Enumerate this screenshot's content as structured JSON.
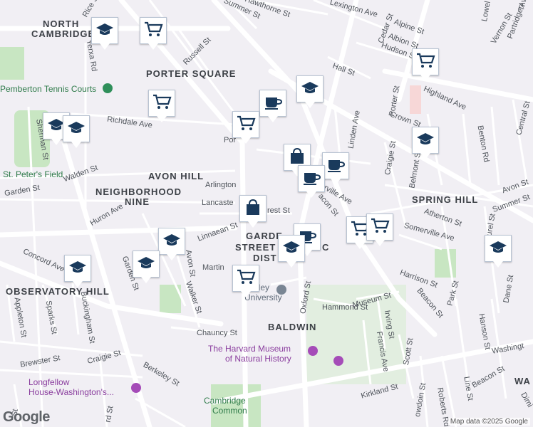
{
  "map": {
    "attribution": "Map data ©2025 Google",
    "logo": "Google",
    "neighborhoods": {
      "north_cambridge_1": "NORTH",
      "north_cambridge_2": "CAMBRIDGE",
      "porter_square": "PORTER SQUARE",
      "avon_hill": "AVON HILL",
      "neighborhood_nine_1": "NEIGHBORHOOD",
      "neighborhood_nine_2": "NINE",
      "observatory_hill": "OBSERVATORY HILL",
      "spring_hill": "SPRING HILL",
      "baldwin": "BALDWIN",
      "garden_street_1": "GARDE",
      "garden_street_2": "STREET",
      "garden_street_3": "DIST",
      "garden_street_4": "C"
    },
    "places": {
      "tennis_courts": "Pemberton Tennis Courts",
      "st_peters_field": "St. Peter's Field",
      "lesley_1": "esley",
      "lesley_2": "University",
      "harvard_museum_1": "The Harvard Museum",
      "harvard_museum_2": "of Natural History",
      "longfellow_1": "Longfellow",
      "longfellow_2": "House-Washington's...",
      "cambridge_common_1": "Cambridge",
      "cambridge_common_2": "Common",
      "porter_partial": "Por"
    },
    "streets": {
      "rice": "Rice St",
      "summer_top": "Summer St",
      "hawthorne": "Hawthorne St",
      "lexington": "Lexington Ave",
      "cedar": "Cedar St",
      "alpine": "Alpine St",
      "albion": "Albion St",
      "hudson": "Hudson St",
      "russell": "Russell St",
      "yerxa": "Yerxa Rd",
      "hall": "Hall St",
      "highland": "Highland Ave",
      "porter": "Porter St",
      "crown": "Crown St",
      "belmont": "Belmont St",
      "benton": "Benton Rd",
      "central": "Central St",
      "richdale": "Richdale Ave",
      "linden": "Linden Ave",
      "sherman": "Sherman St",
      "walden": "Walden St",
      "garden_left": "Garden St",
      "arlington": "Arlington",
      "lancaster": "Lancaste",
      "forest": "rest St",
      "somerville_ave": "merville Ave",
      "beacon_mid": "acon St",
      "avon_st_right": "Avon St",
      "summer_right": "Summer St",
      "atherton": "Atherton St",
      "somerville_ave_right": "Somerville Ave",
      "laurel": "Laurel St",
      "craigie_right": "Craigie St",
      "huron": "Huron Ave",
      "linnaean": "Linnaean St",
      "martin": "Martin",
      "concord": "Concord Ave",
      "avon_left": "Avon St",
      "garden_diag": "Garden St",
      "walker": "Walker St",
      "appleton": "Appleton St",
      "sparks": "Sparks St",
      "buckingham": "Buckingham St",
      "oxford": "Oxford St",
      "hammond": "Hammond St",
      "museum": "Museum St",
      "harrison": "Harrison St",
      "irving": "Irving St",
      "francis": "Francis Ave",
      "scott": "Scott St",
      "beacon_lower": "Beacon St",
      "park": "Park St",
      "hanson": "Hanson St",
      "dane": "Dane St",
      "chauncy": "Chauncy St",
      "craigie_left": "Craigie St",
      "brewster": "Brewster St",
      "berkeley": "Berkeley St",
      "kirkland": "Kirkland St",
      "washington": "Washingt",
      "beacon_bottom": "Beacon St",
      "line": "Line St",
      "bowdoin": "owdoin St",
      "roberts": "Roberts Rd",
      "ware": "WA",
      "dimick": "Dimi",
      "lowell_partial": "Lowel",
      "vernon": "Vernon St",
      "partridge": "Partridge Av",
      "tr": "Tr",
      "st_bottom_left": "St",
      "rd_bottom": "rd St"
    },
    "colors": {
      "background": "#f1eff4",
      "road": "#ffffff",
      "major_road": "#fbfbfb",
      "park": "#c8e6c2",
      "marker_icon": "#1a3a5c",
      "poi": "#8a3d9e"
    },
    "markers": [
      {
        "type": "school-icon"
      },
      {
        "type": "cart-icon"
      },
      {
        "type": "cart-icon"
      },
      {
        "type": "cart-icon"
      },
      {
        "type": "school-icon"
      },
      {
        "type": "school-icon"
      },
      {
        "type": "school-icon"
      },
      {
        "type": "cup-icon"
      },
      {
        "type": "cart-icon"
      },
      {
        "type": "bag-icon"
      },
      {
        "type": "cup-icon"
      },
      {
        "type": "cup-icon"
      },
      {
        "type": "bag-icon"
      },
      {
        "type": "cart-icon"
      },
      {
        "type": "cart-icon"
      },
      {
        "type": "school-icon"
      },
      {
        "type": "school-icon"
      },
      {
        "type": "cup-icon"
      },
      {
        "type": "school-icon"
      },
      {
        "type": "school-icon"
      },
      {
        "type": "school-icon"
      },
      {
        "type": "cart-icon"
      },
      {
        "type": "school-icon"
      }
    ]
  }
}
